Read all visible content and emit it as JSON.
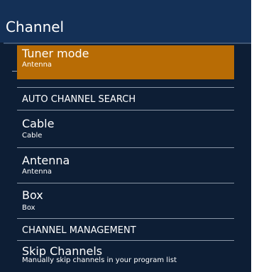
{
  "menu": {
    "title": "Channel",
    "selected_item": {
      "label": "Tuner mode",
      "value": "Antenna"
    },
    "sections": [
      {
        "label": "AUTO CHANNEL SEARCH",
        "items": [
          {
            "label": "Cable",
            "value": "Cable"
          },
          {
            "label": "Antenna",
            "value": "Antenna"
          },
          {
            "label": "Box",
            "value": "Box"
          }
        ]
      },
      {
        "label": "CHANNEL MANAGEMENT",
        "items": [
          {
            "label": "Skip Channels",
            "value": "Manually skip channels in your program list"
          }
        ]
      }
    ],
    "colors": {
      "background": "#0d1e35",
      "header": "#143056",
      "highlight": "#b86c05",
      "text": "#ffffff"
    }
  }
}
